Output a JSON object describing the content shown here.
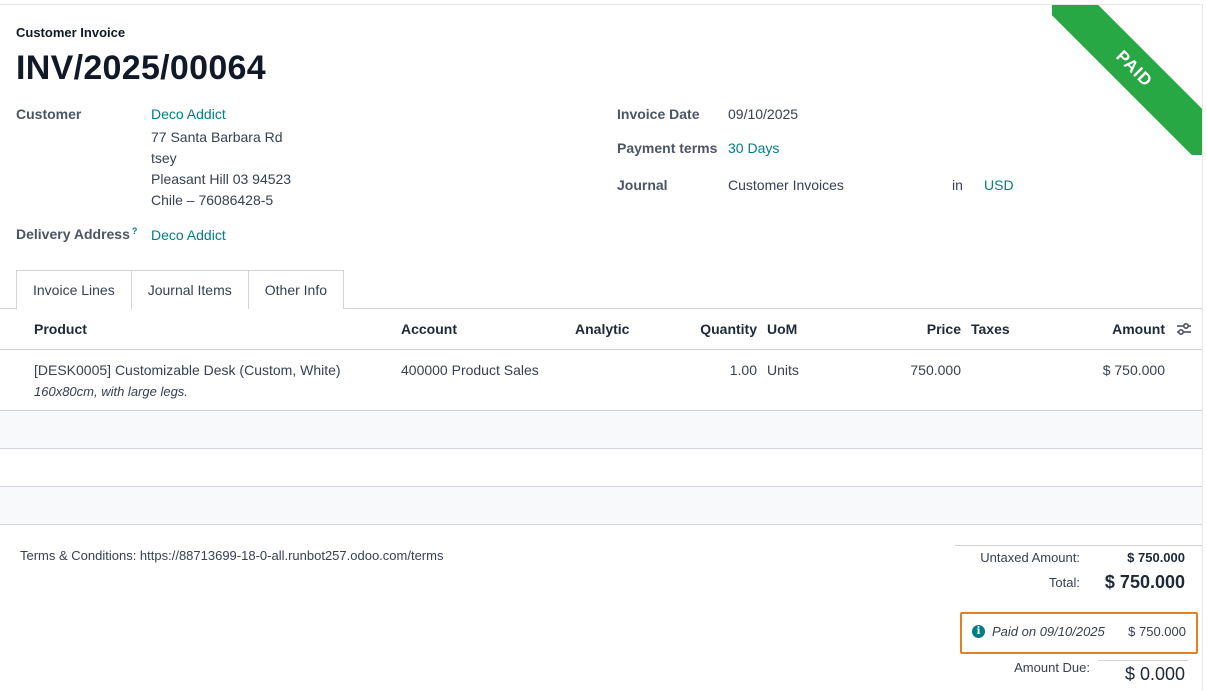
{
  "header": {
    "doc_type": "Customer Invoice",
    "doc_name": "INV/2025/00064",
    "status_ribbon": "PAID",
    "ribbon_color": "#28a745"
  },
  "customer": {
    "label": "Customer",
    "name": "Deco Addict",
    "address_lines": [
      "77 Santa Barbara Rd",
      "tsey",
      "Pleasant Hill 03 94523",
      "Chile – 76086428-5"
    ]
  },
  "delivery": {
    "label": "Delivery Address",
    "help": "?",
    "value": "Deco Addict"
  },
  "invoice_date": {
    "label": "Invoice Date",
    "value": "09/10/2025"
  },
  "payment_terms": {
    "label": "Payment terms",
    "value": "30 Days"
  },
  "journal": {
    "label": "Journal",
    "value": "Customer Invoices",
    "in_label": "in",
    "currency": "USD"
  },
  "tabs": [
    {
      "label": "Invoice Lines",
      "active": true
    },
    {
      "label": "Journal Items",
      "active": false
    },
    {
      "label": "Other Info",
      "active": false
    }
  ],
  "table": {
    "headers": {
      "product": "Product",
      "account": "Account",
      "analytic": "Analytic",
      "quantity": "Quantity",
      "uom": "UoM",
      "price": "Price",
      "taxes": "Taxes",
      "amount": "Amount"
    },
    "rows": [
      {
        "product": "[DESK0005] Customizable Desk (Custom, White)",
        "description": "160x80cm, with large legs.",
        "account": "400000 Product Sales",
        "analytic": "",
        "quantity": "1.00",
        "uom": "Units",
        "price": "750.000",
        "taxes": "",
        "amount": "$ 750.000"
      }
    ]
  },
  "terms": "Terms & Conditions: https://88713699-18-0-all.runbot257.odoo.com/terms",
  "totals": {
    "untaxed_label": "Untaxed Amount:",
    "untaxed_value": "$ 750.000",
    "total_label": "Total:",
    "total_value": "$ 750.000",
    "payment_text": "Paid on 09/10/2025",
    "payment_amount": "$ 750.000",
    "due_label": "Amount Due:",
    "due_value": "$ 0.000"
  },
  "colors": {
    "link": "#017e84",
    "highlight_border": "#e67e22"
  }
}
